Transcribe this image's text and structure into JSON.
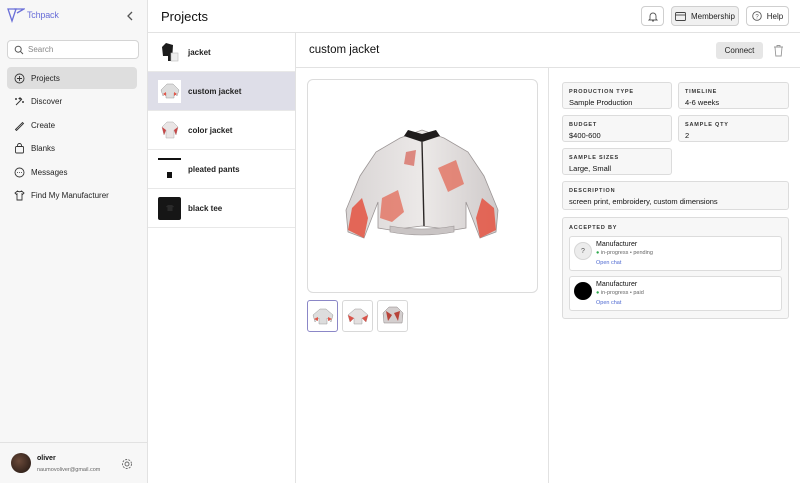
{
  "app": {
    "logo_text": "Tchpack"
  },
  "search": {
    "placeholder": "Search"
  },
  "sidebar": {
    "items": [
      {
        "label": "Projects",
        "icon": "plus-circle-icon",
        "active": true
      },
      {
        "label": "Discover",
        "icon": "sparkle-icon",
        "active": false
      },
      {
        "label": "Create",
        "icon": "pencil-icon",
        "active": false
      },
      {
        "label": "Blanks",
        "icon": "bag-icon",
        "active": false
      },
      {
        "label": "Messages",
        "icon": "chat-icon",
        "active": false
      },
      {
        "label": "Find My Manufacturer",
        "icon": "shirt-icon",
        "active": false
      }
    ]
  },
  "user": {
    "name": "oliver",
    "email": "naumovoliver@gmail.com"
  },
  "header": {
    "title": "Projects",
    "membership": "Membership",
    "help": "Help"
  },
  "projects": [
    {
      "name": "jacket"
    },
    {
      "name": "custom jacket"
    },
    {
      "name": "color jacket"
    },
    {
      "name": "pleated pants"
    },
    {
      "name": "black tee"
    }
  ],
  "detail": {
    "title": "custom jacket",
    "connect": "Connect",
    "production_type": {
      "label": "PRODUCTION TYPE",
      "value": "Sample Production"
    },
    "timeline": {
      "label": "TIMELINE",
      "value": "4-6 weeks"
    },
    "budget": {
      "label": "BUDGET",
      "value": "$400-600"
    },
    "sample_qty": {
      "label": "SAMPLE QTY",
      "value": "2"
    },
    "sample_sizes": {
      "label": "SAMPLE SIZES",
      "value": "Large, Small"
    },
    "description": {
      "label": "DESCRIPTION",
      "value": "screen print, embroidery, custom dimensions"
    },
    "accepted_by": {
      "label": "ACCEPTED BY",
      "manufacturers": [
        {
          "name": "Manufacturer",
          "avatar": "?",
          "status": "in-progress • pending",
          "chat": "Open chat"
        },
        {
          "name": "Manufacturer",
          "avatar": "",
          "status": "in-progress • paid",
          "chat": "Open chat"
        }
      ]
    }
  },
  "colors": {
    "accent": "#6a6fd8",
    "active_row": "#dedee8",
    "status_dot": "#2ba84a",
    "link": "#4f6ad1"
  }
}
